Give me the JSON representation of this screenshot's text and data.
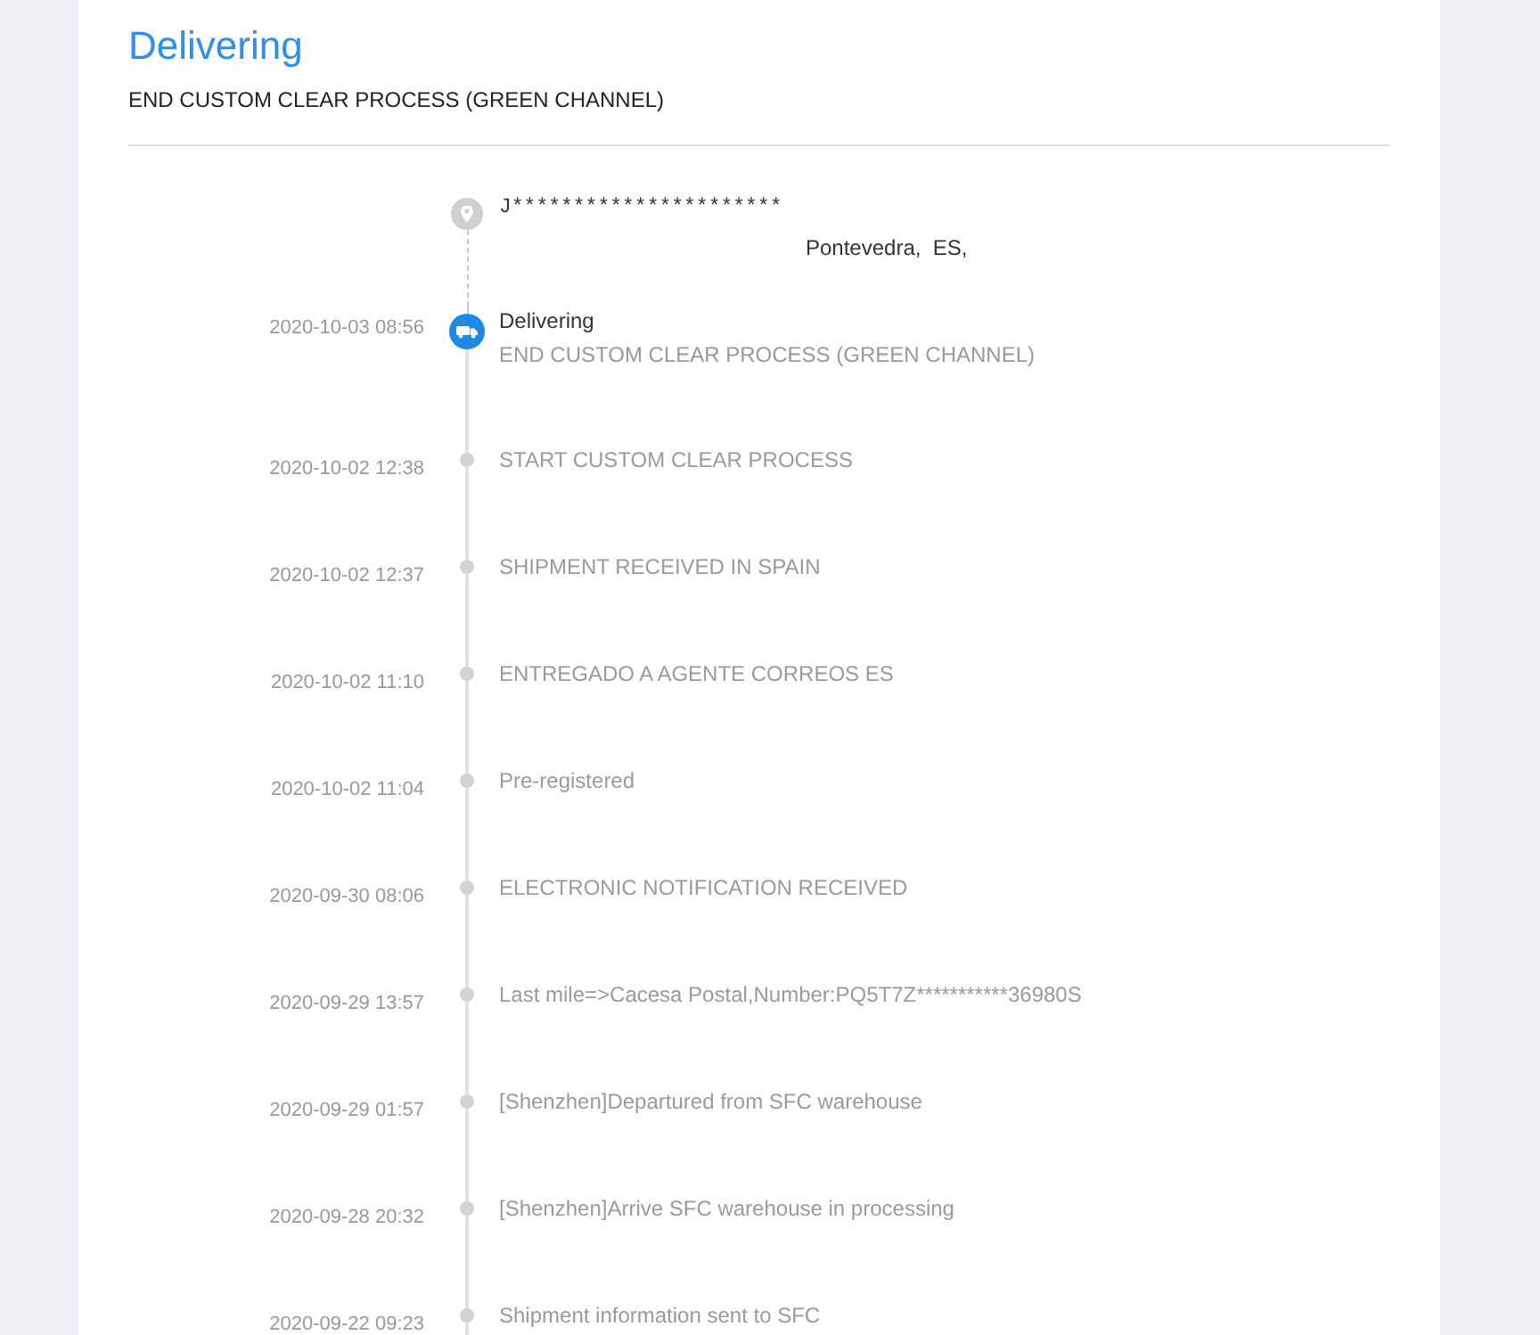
{
  "header": {
    "status": "Delivering",
    "description": "END CUSTOM CLEAR PROCESS (GREEN CHANNEL)"
  },
  "timeline": {
    "destination": {
      "recipient": "J**********************",
      "location": "Pontevedra,  ES,"
    },
    "events": [
      {
        "time": "2020-10-03 08:56",
        "status": "Delivering",
        "description": "END CUSTOM CLEAR PROCESS (GREEN CHANNEL)",
        "current": true
      },
      {
        "time": "2020-10-02 12:38",
        "description": "START CUSTOM CLEAR PROCESS",
        "current": false
      },
      {
        "time": "2020-10-02 12:37",
        "description": "SHIPMENT RECEIVED IN SPAIN",
        "current": false
      },
      {
        "time": "2020-10-02 11:10",
        "description": "ENTREGADO A AGENTE CORREOS ES",
        "current": false
      },
      {
        "time": "2020-10-02 11:04",
        "description": "Pre-registered",
        "current": false
      },
      {
        "time": "2020-09-30 08:06",
        "description": "ELECTRONIC NOTIFICATION RECEIVED",
        "current": false
      },
      {
        "time": "2020-09-29 13:57",
        "description": "Last mile=>Cacesa Postal,Number:PQ5T7Z***********36980S",
        "current": false
      },
      {
        "time": "2020-09-29 01:57",
        "description": "[Shenzhen]Departured from SFC warehouse",
        "current": false
      },
      {
        "time": "2020-09-28 20:32",
        "description": "[Shenzhen]Arrive SFC warehouse in processing",
        "current": false
      },
      {
        "time": "2020-09-22 09:23",
        "description": "Shipment information sent to SFC",
        "current": false
      }
    ]
  }
}
